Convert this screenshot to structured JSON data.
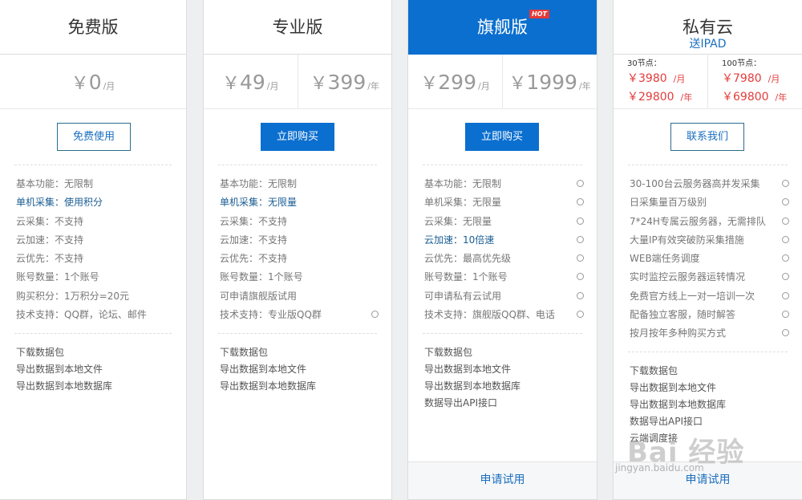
{
  "plans": [
    {
      "title": "免费版",
      "prices": [
        {
          "currency": "￥",
          "amount": "0",
          "per": "/月"
        }
      ],
      "button": "免费使用",
      "features": [
        "基本功能：无限制",
        "单机采集：使用积分",
        "云采集：不支持",
        "云加速：不支持",
        "云优先：不支持",
        "账号数量：1个账号",
        "购买积分：1万积分=20元",
        "技术支持：QQ群，论坛、邮件"
      ],
      "extras": [
        "下载数据包",
        "导出数据到本地文件",
        "导出数据到本地数据库"
      ]
    },
    {
      "title": "专业版",
      "prices": [
        {
          "currency": "￥",
          "amount": "49",
          "per": "/月"
        },
        {
          "currency": "￥",
          "amount": "399",
          "per": "/年"
        }
      ],
      "button": "立即购买",
      "features": [
        "基本功能：无限制",
        "单机采集：无限量",
        "云采集：不支持",
        "云加速：不支持",
        "云优先：不支持",
        "账号数量：1个账号",
        "可申请旗舰版试用",
        "技术支持：专业版QQ群"
      ],
      "extras": [
        "下载数据包",
        "导出数据到本地文件",
        "导出数据到本地数据库"
      ]
    },
    {
      "title": "旗舰版",
      "hot_badge": "HOT",
      "prices": [
        {
          "currency": "￥",
          "amount": "299",
          "per": "/月"
        },
        {
          "currency": "￥",
          "amount": "1999",
          "per": "/年"
        }
      ],
      "button": "立即购买",
      "features": [
        "基本功能：无限制",
        "单机采集：无限量",
        "云采集：无限量",
        "云加速：10倍速",
        "云优先：最高优先级",
        "账号数量：1个账号",
        "可申请私有云试用",
        "技术支持：旗舰版QQ群、电话"
      ],
      "extras": [
        "下载数据包",
        "导出数据到本地文件",
        "导出数据到本地数据库",
        "数据导出API接口"
      ],
      "footer": "申请试用"
    },
    {
      "title": "私有云",
      "subtitle": "送IPAD",
      "nodes": [
        {
          "label": "30节点：",
          "monthly": "￥3980",
          "monthly_unit": "/月",
          "yearly": "￥29800",
          "yearly_unit": "/年"
        },
        {
          "label": "100节点：",
          "monthly": "￥7980",
          "monthly_unit": "/月",
          "yearly": "￥69800",
          "yearly_unit": "/年"
        }
      ],
      "button": "联系我们",
      "features": [
        "30-100台云服务器高并发采集",
        "日采集量百万级别",
        "7*24H专属云服务器，无需排队",
        "大量IP有效突破防采集措施",
        "WEB端任务调度",
        "实时监控云服务器运转情况",
        "免费官方线上一对一培训一次",
        "配备独立客服，随时解答",
        "按月按年多种购买方式"
      ],
      "extras": [
        "下载数据包",
        "导出数据到本地文件",
        "导出数据到本地数据库",
        "数据导出API接口",
        "云端调度接"
      ],
      "footer": "申请试用"
    }
  ],
  "watermark": {
    "brand": "Bai 经验",
    "url": "jingyan.baidu.com"
  },
  "colors": {
    "accent": "#0b6fcf",
    "price_red": "#e43c3c",
    "hot_badge": "#e43a3a"
  }
}
